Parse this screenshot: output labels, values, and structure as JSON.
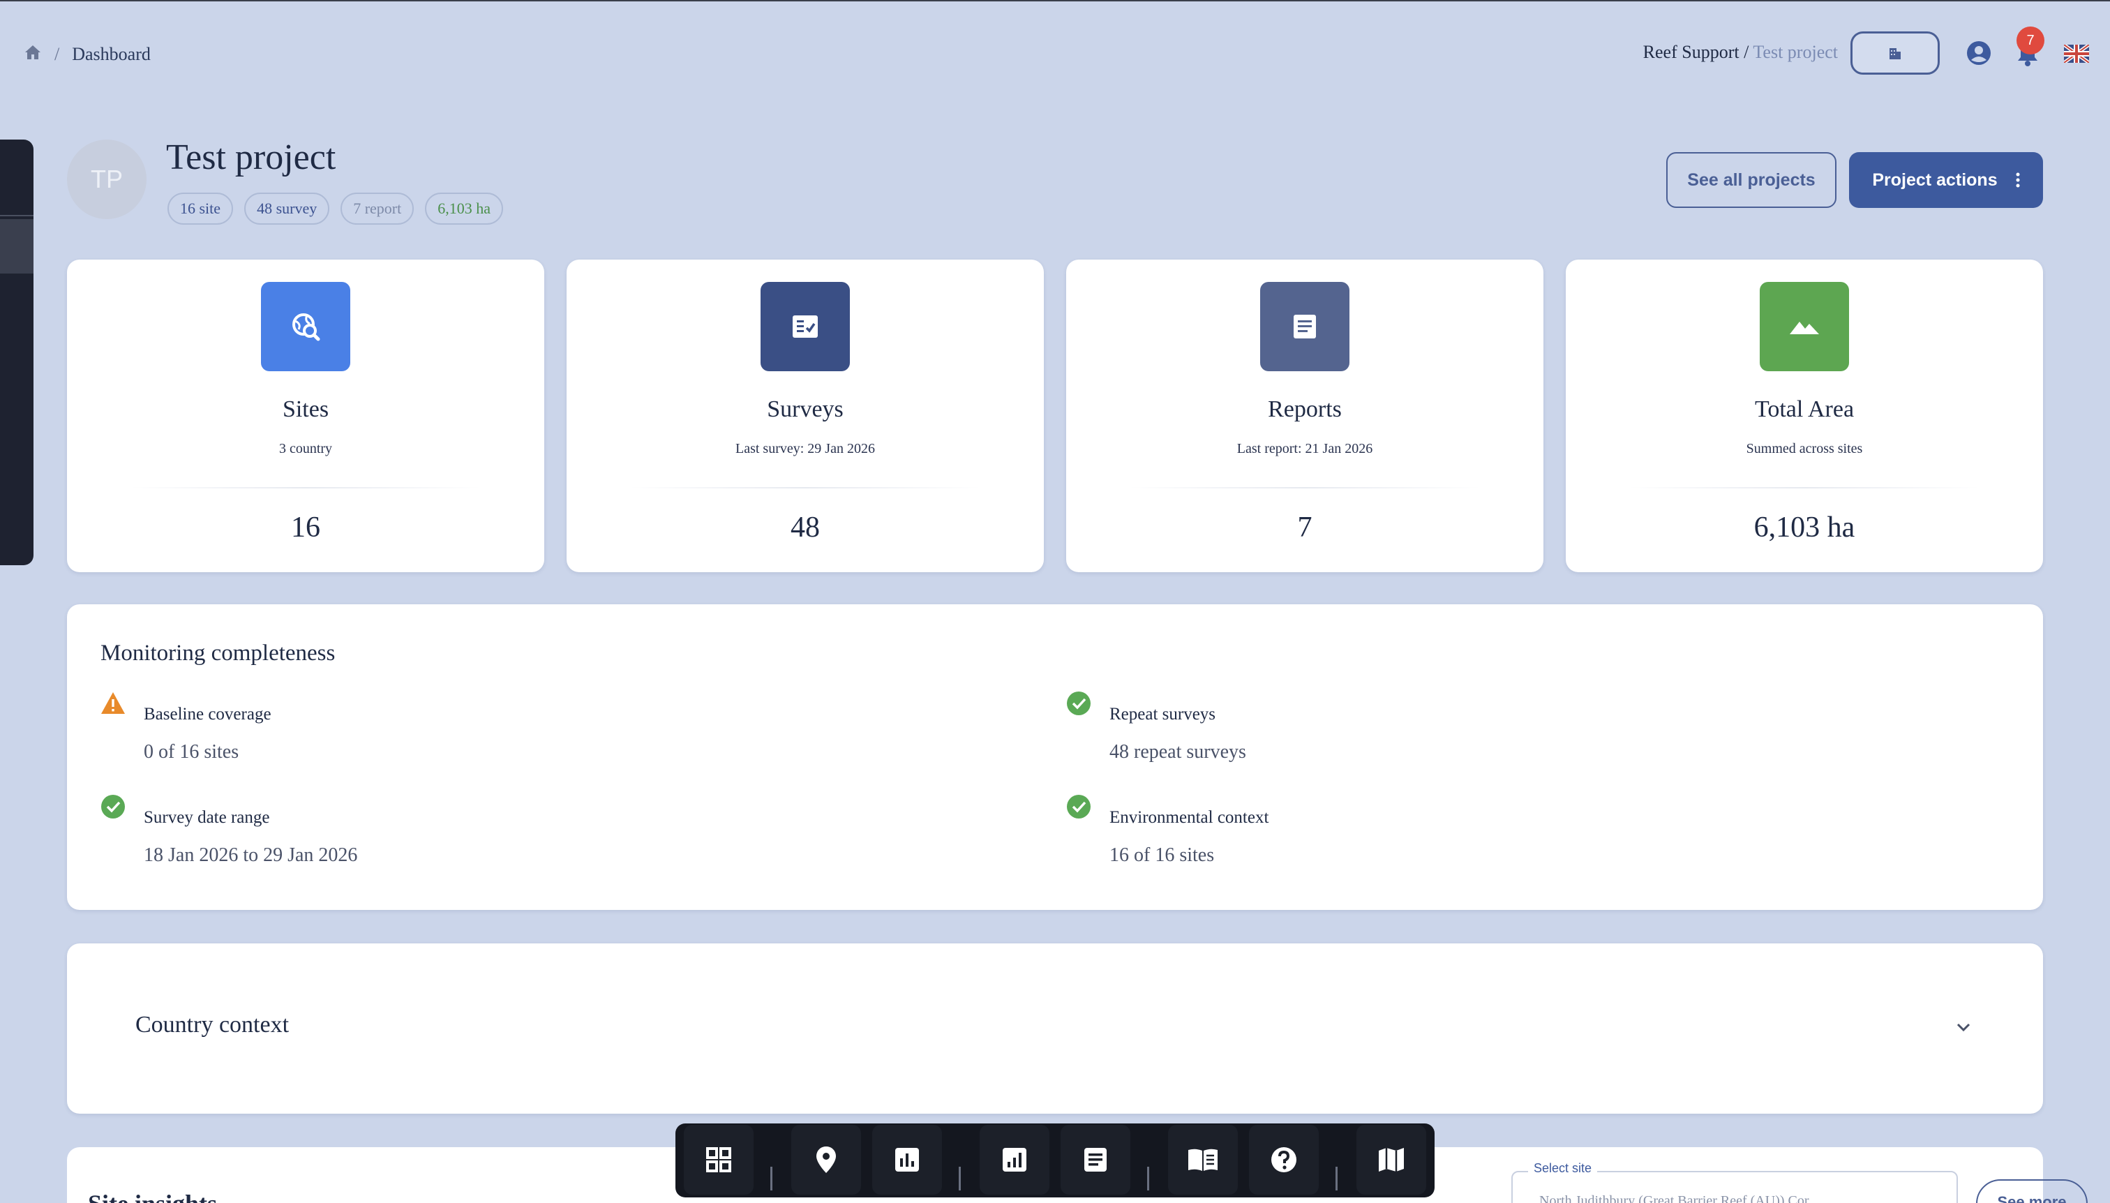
{
  "breadcrumb": {
    "current": "Dashboard"
  },
  "topbar": {
    "org": "Reef Support",
    "separator": "/",
    "project": "Test project",
    "notifications": "7"
  },
  "project": {
    "initials": "TP",
    "title": "Test project",
    "chips": [
      "16 site",
      "48 survey",
      "7 report",
      "6,103 ha"
    ],
    "see_all": "See all projects",
    "actions": "Project actions"
  },
  "cards": [
    {
      "name": "Sites",
      "sub": "3 country",
      "value": "16",
      "icon": "globe-search-icon",
      "color": "#4a80e6"
    },
    {
      "name": "Surveys",
      "sub": "Last survey: 29 Jan 2026",
      "value": "48",
      "icon": "checklist-icon",
      "color": "#3a4f85"
    },
    {
      "name": "Reports",
      "sub": "Last report: 21 Jan 2026",
      "value": "7",
      "icon": "document-icon",
      "color": "#54648f"
    },
    {
      "name": "Total Area",
      "sub": "Summed across sites",
      "value": "6,103 ha",
      "icon": "landscape-icon",
      "color": "#5da651"
    }
  ],
  "monitoring": {
    "title": "Monitoring completeness",
    "items": [
      {
        "label": "Baseline coverage",
        "value": "0 of 16 sites",
        "status": "warning"
      },
      {
        "label": "Repeat surveys",
        "value": "48 repeat surveys",
        "status": "ok"
      },
      {
        "label": "Survey date range",
        "value": "18 Jan 2026 to 29 Jan 2026",
        "status": "ok"
      },
      {
        "label": "Environmental context",
        "value": "16 of 16 sites",
        "status": "ok"
      }
    ]
  },
  "country": {
    "title": "Country context"
  },
  "insights": {
    "title": "Site insights",
    "select_label": "Select site",
    "select_value": "North Judithbury (Great Barrier Reef (AU)) Cor",
    "see_more": "See more"
  },
  "dock": {
    "icons": [
      "grid-icon",
      "location-pin-icon",
      "bar-chart-icon",
      "analytics-icon",
      "report-icon",
      "book-icon",
      "help-icon",
      "map-icon"
    ]
  }
}
